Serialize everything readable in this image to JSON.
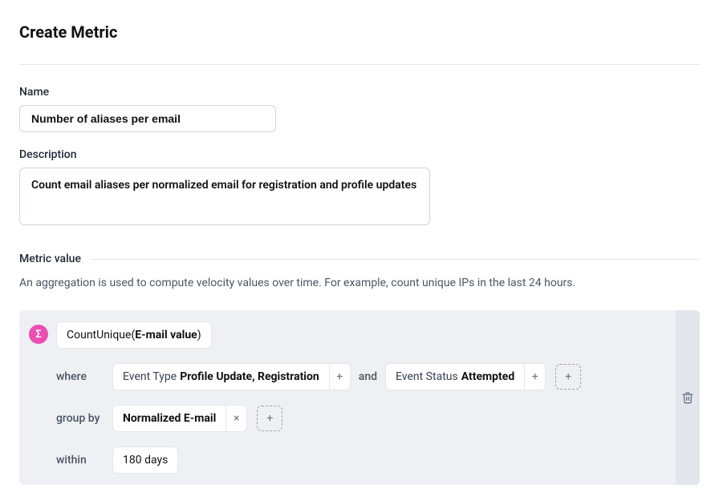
{
  "title": "Create Metric",
  "name_label": "Name",
  "name_value": "Number of aliases per email",
  "description_label": "Description",
  "description_value": "Count email aliases per normalized email for registration and profile updates",
  "metric_value_section": "Metric value",
  "helper_text": "An aggregation is used to compute velocity values over time. For example, count unique IPs in the last 24 hours.",
  "aggregation": {
    "func": "CountUnique",
    "field": "E-mail value"
  },
  "where": {
    "label": "where",
    "and_label": "and",
    "conditions": [
      {
        "attr": "Event Type",
        "value": "Profile Update, Registration"
      },
      {
        "attr": "Event Status",
        "value": "Attempted"
      }
    ]
  },
  "group_by": {
    "label": "group by",
    "items": [
      "Normalized E-mail"
    ]
  },
  "within": {
    "label": "within",
    "value": "180 days"
  }
}
